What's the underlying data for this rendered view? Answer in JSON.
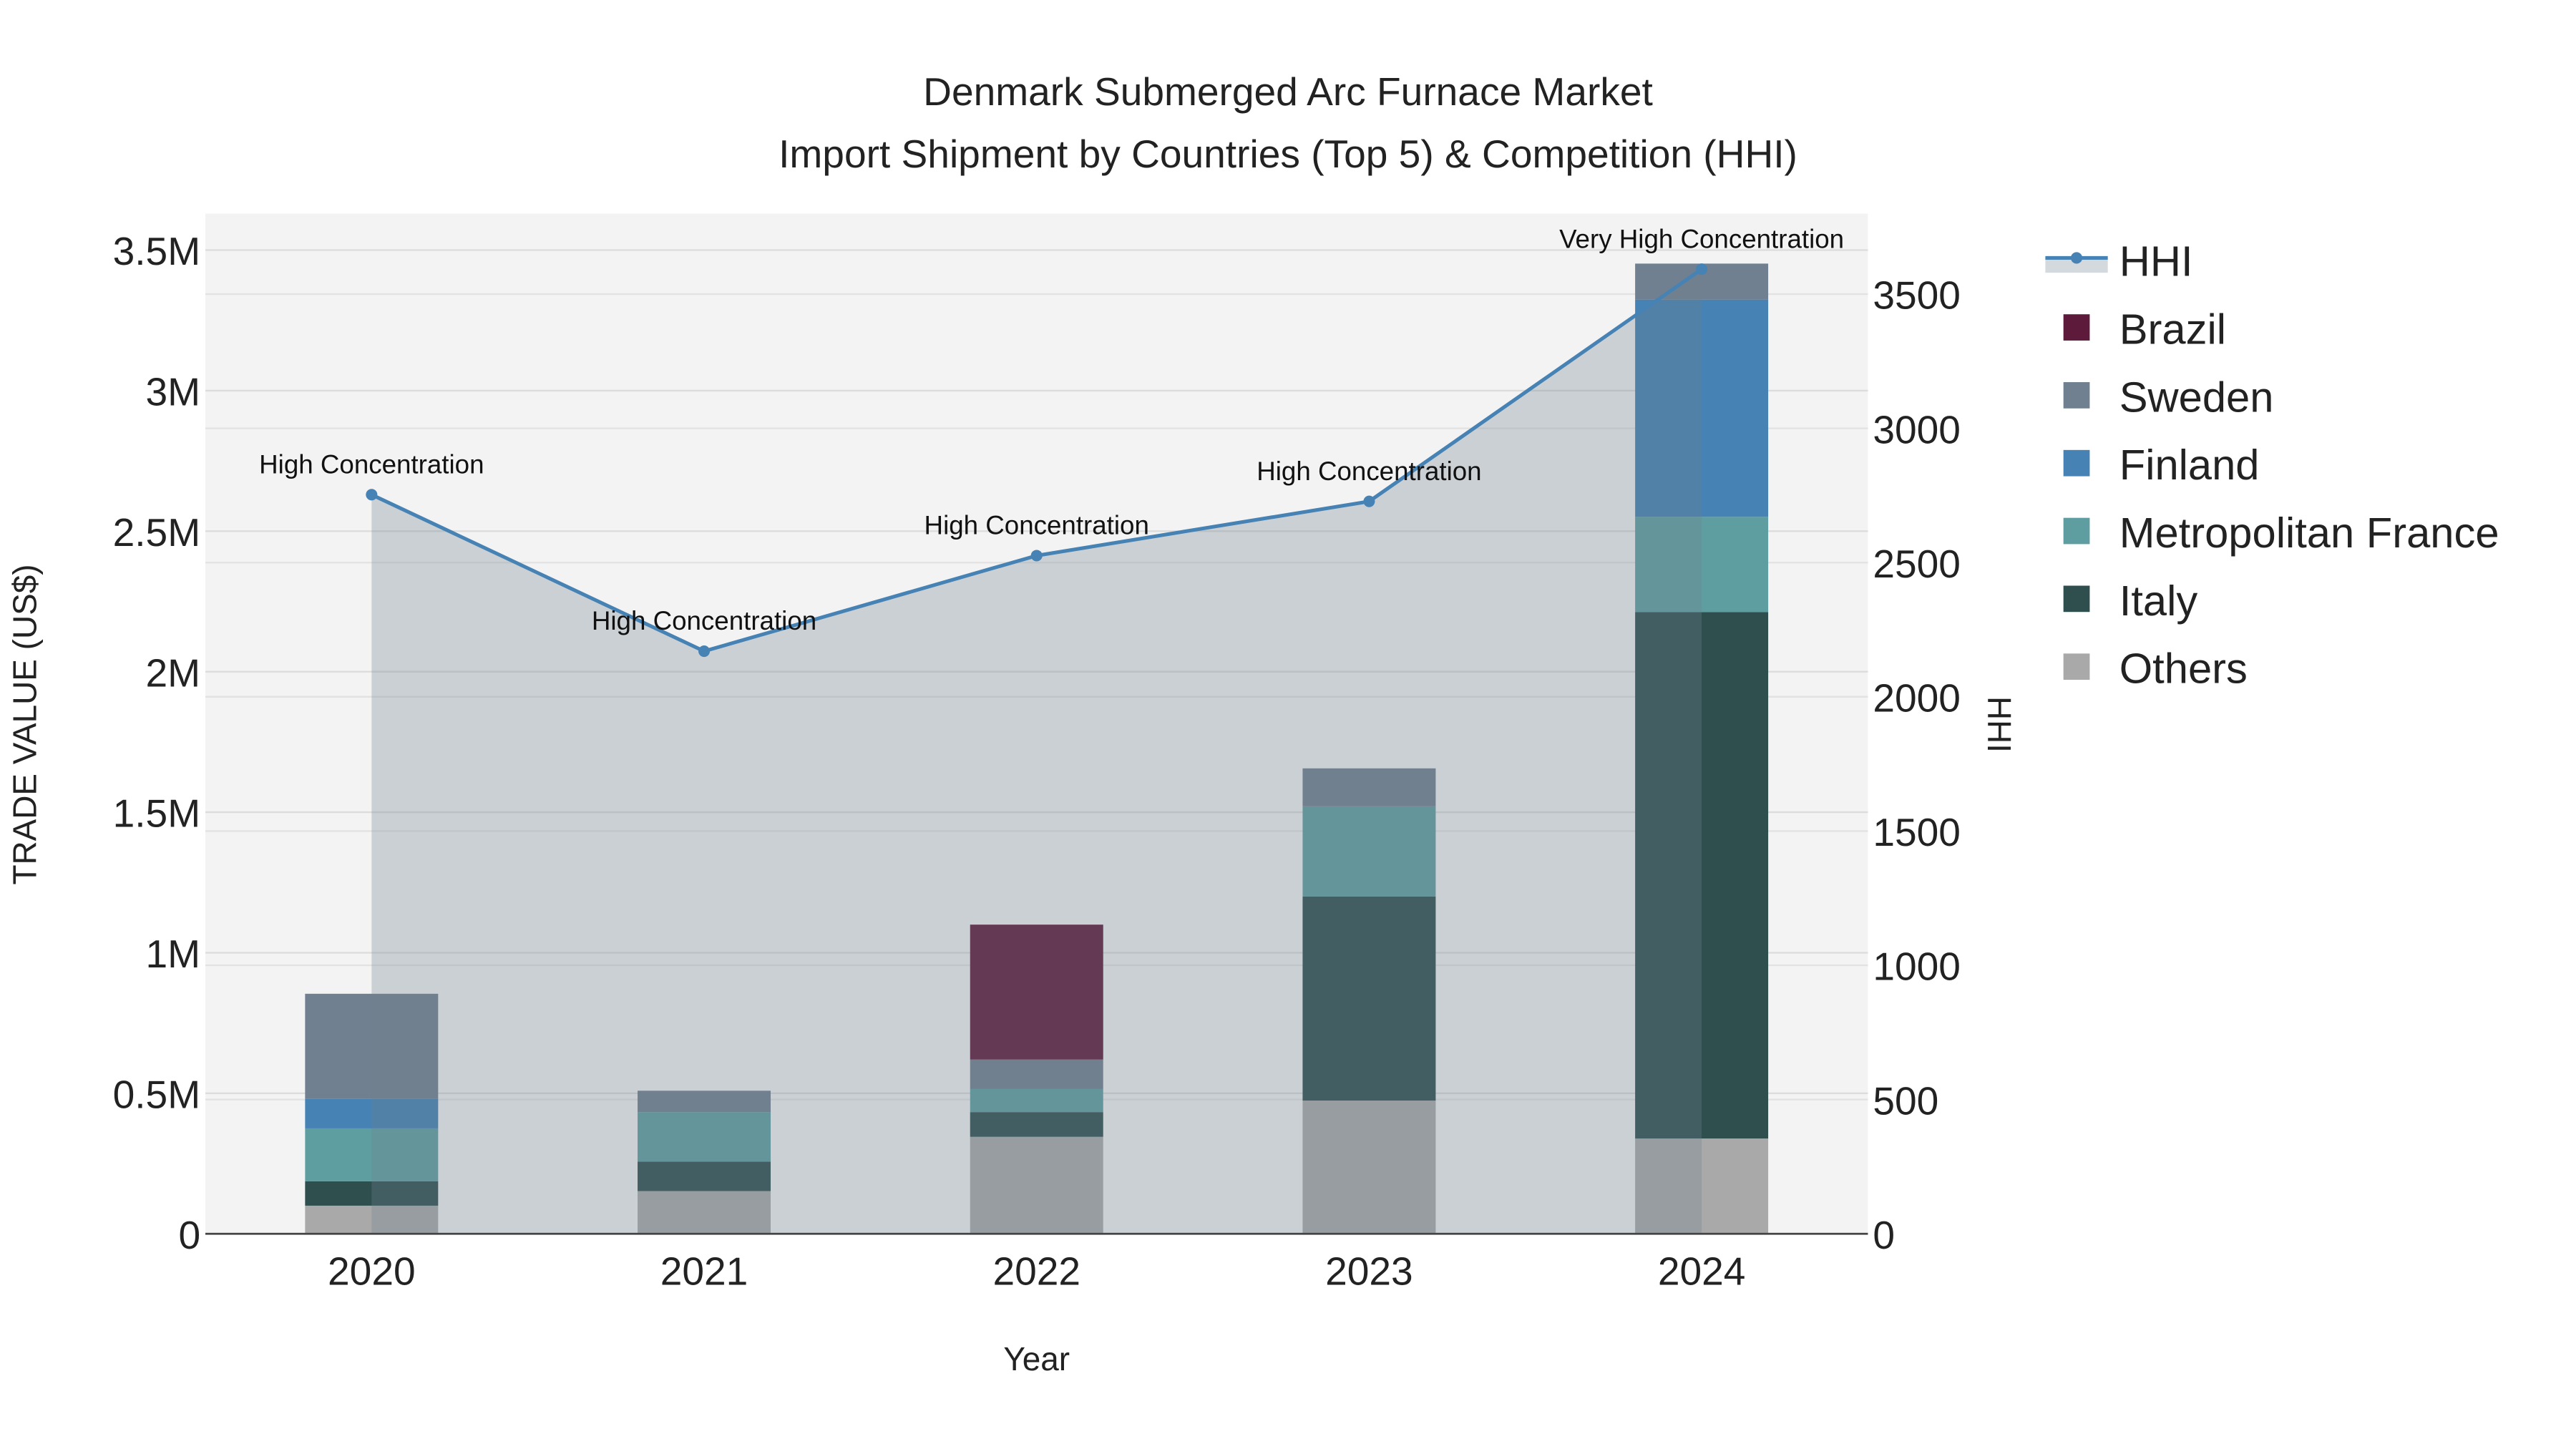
{
  "chart_data": {
    "type": "bar",
    "title": "Denmark Submerged Arc Furnace Market",
    "subtitle": "Import Shipment by Countries (Top 5) & Competition (HHI)",
    "xlabel": "Year",
    "ylabel": "TRADE VALUE (US$)",
    "y2label": "HHI",
    "categories": [
      "2020",
      "2021",
      "2022",
      "2023",
      "2024"
    ],
    "ylim": [
      0,
      3630000
    ],
    "y2lim": [
      0,
      3800
    ],
    "yticks": [
      {
        "v": 0,
        "label": "0"
      },
      {
        "v": 500000,
        "label": "0.5M"
      },
      {
        "v": 1000000,
        "label": "1M"
      },
      {
        "v": 1500000,
        "label": "1.5M"
      },
      {
        "v": 2000000,
        "label": "2M"
      },
      {
        "v": 2500000,
        "label": "2.5M"
      },
      {
        "v": 3000000,
        "label": "3M"
      },
      {
        "v": 3500000,
        "label": "3.5M"
      }
    ],
    "y2ticks": [
      {
        "v": 0,
        "label": "0"
      },
      {
        "v": 500,
        "label": "500"
      },
      {
        "v": 1000,
        "label": "1000"
      },
      {
        "v": 1500,
        "label": "1500"
      },
      {
        "v": 2000,
        "label": "2000"
      },
      {
        "v": 2500,
        "label": "2500"
      },
      {
        "v": 3000,
        "label": "3000"
      },
      {
        "v": 3500,
        "label": "3500"
      }
    ],
    "stacked": true,
    "series": [
      {
        "name": "Others",
        "color": "#a9a9a9",
        "values": [
          100000,
          152000,
          345000,
          474000,
          339000
        ]
      },
      {
        "name": "Italy",
        "color": "#2f4f4f",
        "values": [
          87000,
          105000,
          88000,
          726000,
          1873000
        ]
      },
      {
        "name": "Metropolitan France",
        "color": "#5f9ea0",
        "values": [
          188000,
          176000,
          82000,
          321000,
          339000
        ]
      },
      {
        "name": "Finland",
        "color": "#4682b4",
        "values": [
          105000,
          0,
          0,
          0,
          773000
        ]
      },
      {
        "name": "Sweden",
        "color": "#708090",
        "values": [
          374000,
          76000,
          105000,
          135000,
          128000
        ]
      },
      {
        "name": "Brazil",
        "color": "#5e1a3a",
        "values": [
          0,
          0,
          480000,
          0,
          0
        ]
      }
    ],
    "hhi": {
      "name": "HHI",
      "color": "#4682b4",
      "values": [
        2753,
        2170,
        2526,
        2728,
        3593
      ],
      "annotations": [
        "High Concentration",
        "High Concentration",
        "High Concentration",
        "High Concentration",
        "Very High Concentration"
      ]
    },
    "legend": {
      "placement": "right",
      "order": [
        "HHI",
        "Brazil",
        "Sweden",
        "Finland",
        "Metropolitan France",
        "Italy",
        "Others"
      ]
    }
  }
}
